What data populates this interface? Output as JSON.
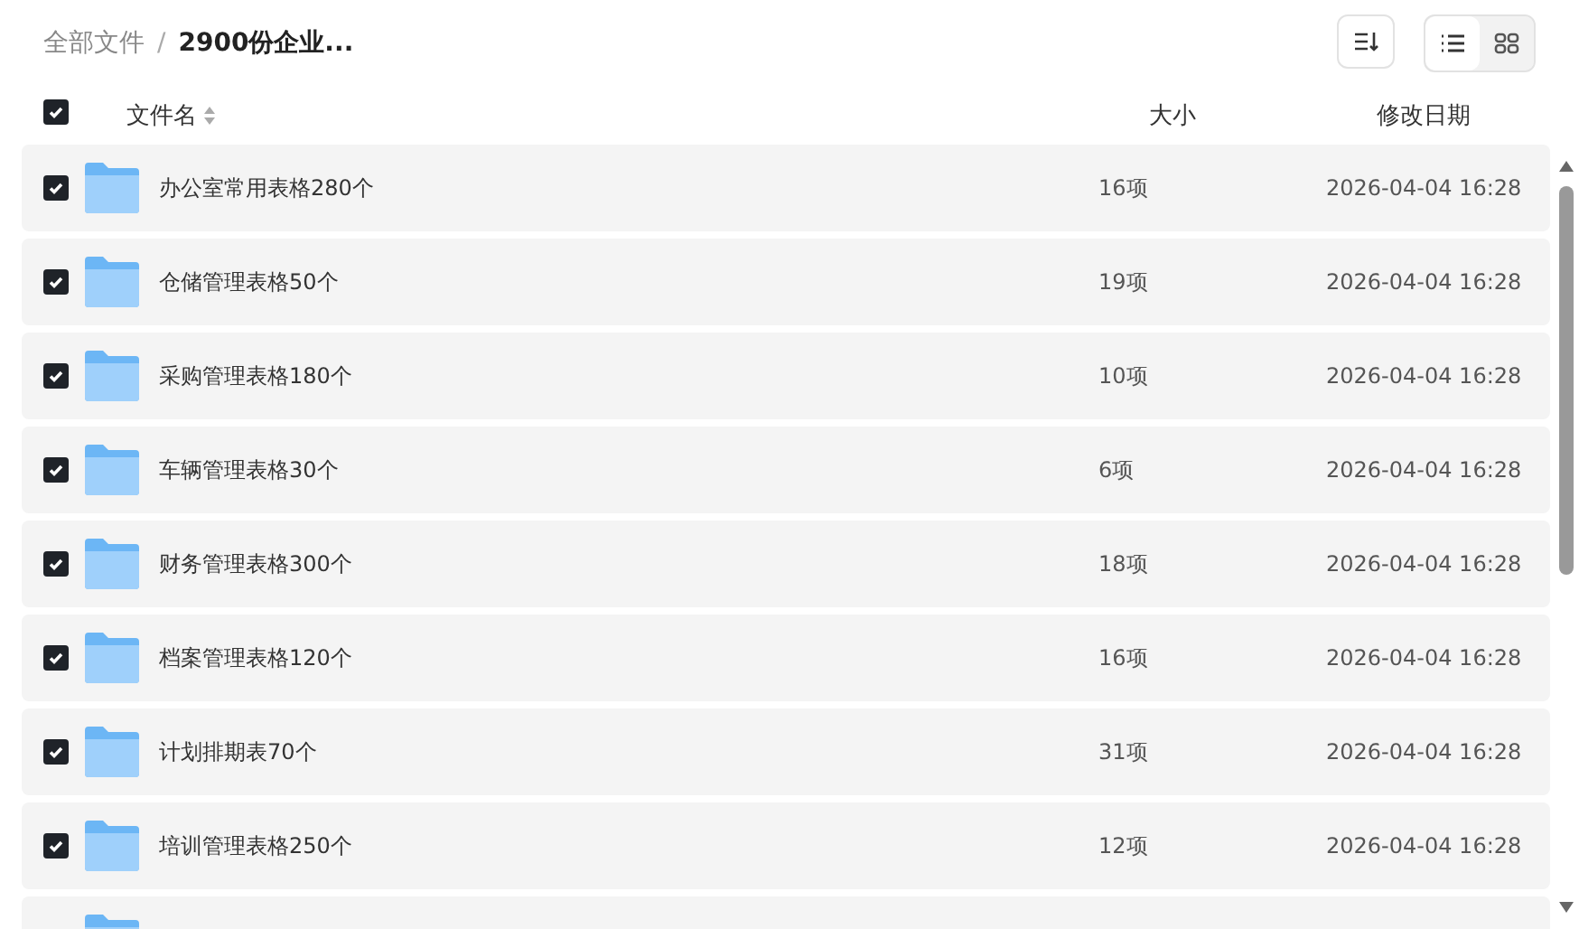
{
  "breadcrumb": [
    {
      "label": "全部文件",
      "current": false
    },
    {
      "label": "2900份企业...",
      "current": true
    }
  ],
  "breadcrumb_separator": "/",
  "view_toggle": [
    {
      "kind": "list",
      "selected": true
    },
    {
      "kind": "grid",
      "selected": false
    }
  ],
  "header": {
    "checked": true,
    "columns": [
      "文件名",
      "大小",
      "修改日期"
    ]
  },
  "rows": [
    {
      "checked": true,
      "name": "办公室常用表格280个",
      "size": "16项",
      "date": "2026-04-04 16:28"
    },
    {
      "checked": true,
      "name": "仓储管理表格50个",
      "size": "19项",
      "date": "2026-04-04 16:28"
    },
    {
      "checked": true,
      "name": "采购管理表格180个",
      "size": "10项",
      "date": "2026-04-04 16:28"
    },
    {
      "checked": true,
      "name": "车辆管理表格30个",
      "size": "6项",
      "date": "2026-04-04 16:28"
    },
    {
      "checked": true,
      "name": "财务管理表格300个",
      "size": "18项",
      "date": "2026-04-04 16:28"
    },
    {
      "checked": true,
      "name": "档案管理表格120个",
      "size": "16项",
      "date": "2026-04-04 16:28"
    },
    {
      "checked": true,
      "name": "计划排期表70个",
      "size": "31项",
      "date": "2026-04-04 16:28"
    },
    {
      "checked": true,
      "name": "培训管理表格250个",
      "size": "12项",
      "date": "2026-04-04 16:28"
    },
    {}
  ]
}
